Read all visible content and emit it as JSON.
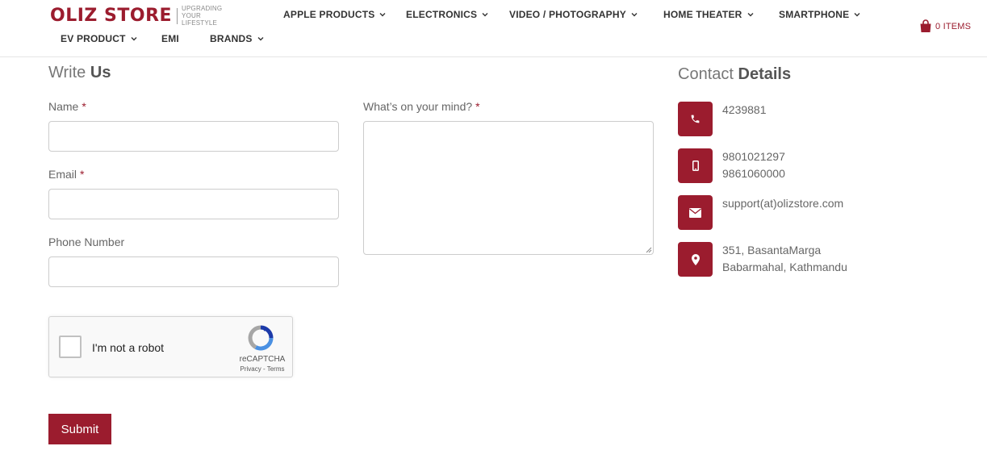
{
  "header": {
    "logo": {
      "name": "OLIZ STORE",
      "tagline_line1": "UPGRADING",
      "tagline_line2": "YOUR LIFESTYLE"
    },
    "nav": [
      {
        "label": "APPLE PRODUCTS",
        "has_dropdown": true
      },
      {
        "label": "ELECTRONICS",
        "has_dropdown": true
      },
      {
        "label": "VIDEO / PHOTOGRAPHY",
        "has_dropdown": true
      },
      {
        "label": "HOME THEATER",
        "has_dropdown": true
      },
      {
        "label": "SMARTPHONE",
        "has_dropdown": true
      },
      {
        "label": "EV PRODUCT",
        "has_dropdown": true
      },
      {
        "label": "EMI",
        "has_dropdown": false
      },
      {
        "label": "BRANDS",
        "has_dropdown": true
      }
    ],
    "cart": {
      "label": "0 ITEMS",
      "icon": "shopping-bag-icon"
    }
  },
  "write_us": {
    "title_light": "Write",
    "title_bold": "Us",
    "name_label": "Name",
    "email_label": "Email",
    "phone_label": "Phone Number",
    "message_label": "What’s on your mind?",
    "required_mark": "*",
    "name_value": "",
    "email_value": "",
    "phone_value": "",
    "message_value": "",
    "captcha": {
      "label": "I'm not a robot",
      "brand": "reCAPTCHA",
      "links": "Privacy - Terms"
    },
    "submit_label": "Submit"
  },
  "contact": {
    "title_light": "Contact",
    "title_bold": "Details",
    "phone": "4239881",
    "mobile_1": "9801021297",
    "mobile_2": "9861060000",
    "email": "support(at)olizstore.com",
    "address_1": "351, BasantaMarga",
    "address_2": "Babarmahal, Kathmandu"
  },
  "colors": {
    "brand": "#9b1c2e",
    "text": "#333333",
    "muted": "#666666"
  }
}
